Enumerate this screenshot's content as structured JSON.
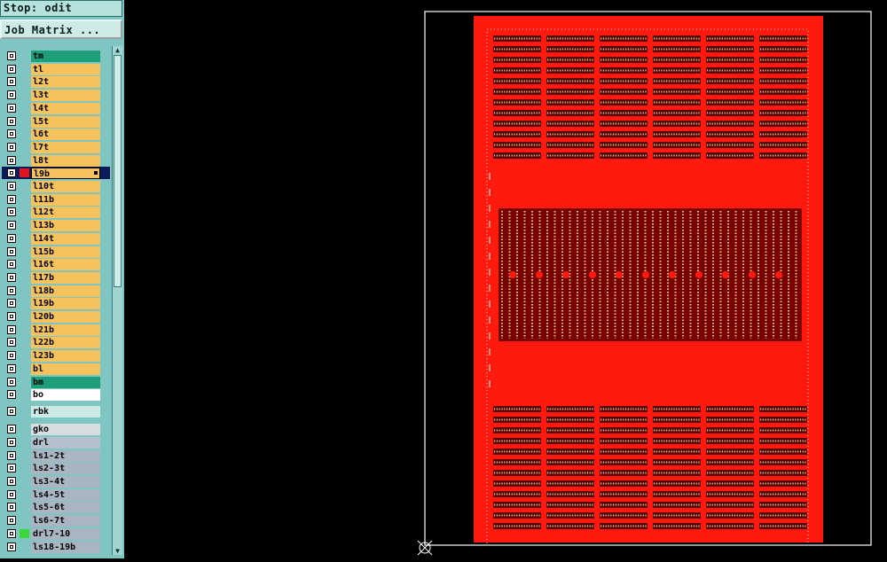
{
  "header": {
    "status": "Stop: odit",
    "job_button": "Job Matrix ..."
  },
  "layers": [
    {
      "name": "tm",
      "color": "#1f9e7a",
      "bg": "teal",
      "selected": false
    },
    {
      "name": "tl",
      "color": "#f6c25e",
      "bg": "gold",
      "selected": false
    },
    {
      "name": "l2t",
      "color": "#f6c25e",
      "bg": "gold",
      "selected": false
    },
    {
      "name": "l3t",
      "color": "#f6c25e",
      "bg": "gold",
      "selected": false
    },
    {
      "name": "l4t",
      "color": "#f6c25e",
      "bg": "gold",
      "selected": false
    },
    {
      "name": "l5t",
      "color": "#f6c25e",
      "bg": "gold",
      "selected": false
    },
    {
      "name": "l6t",
      "color": "#f6c25e",
      "bg": "gold",
      "selected": false
    },
    {
      "name": "l7t",
      "color": "#f6c25e",
      "bg": "gold",
      "selected": false
    },
    {
      "name": "l8t",
      "color": "#f6c25e",
      "bg": "gold",
      "selected": false
    },
    {
      "name": "l9b",
      "color": "#f6c25e",
      "bg": "gold",
      "selected": true
    },
    {
      "name": "l10t",
      "color": "#f6c25e",
      "bg": "gold",
      "selected": false
    },
    {
      "name": "l11b",
      "color": "#f6c25e",
      "bg": "gold",
      "selected": false
    },
    {
      "name": "l12t",
      "color": "#f6c25e",
      "bg": "gold",
      "selected": false
    },
    {
      "name": "l13b",
      "color": "#f6c25e",
      "bg": "gold",
      "selected": false
    },
    {
      "name": "l14t",
      "color": "#f6c25e",
      "bg": "gold",
      "selected": false
    },
    {
      "name": "l15b",
      "color": "#f6c25e",
      "bg": "gold",
      "selected": false
    },
    {
      "name": "l16t",
      "color": "#f6c25e",
      "bg": "gold",
      "selected": false
    },
    {
      "name": "l17b",
      "color": "#f6c25e",
      "bg": "gold",
      "selected": false
    },
    {
      "name": "l18b",
      "color": "#f6c25e",
      "bg": "gold",
      "selected": false
    },
    {
      "name": "l19b",
      "color": "#f6c25e",
      "bg": "gold",
      "selected": false
    },
    {
      "name": "l20b",
      "color": "#f6c25e",
      "bg": "gold",
      "selected": false
    },
    {
      "name": "l21b",
      "color": "#f6c25e",
      "bg": "gold",
      "selected": false
    },
    {
      "name": "l22b",
      "color": "#f6c25e",
      "bg": "gold",
      "selected": false
    },
    {
      "name": "l23b",
      "color": "#f6c25e",
      "bg": "gold",
      "selected": false
    },
    {
      "name": "bl",
      "color": "#f6c25e",
      "bg": "gold",
      "selected": false
    },
    {
      "name": "bm",
      "color": "#1f9e7a",
      "bg": "teal",
      "selected": false
    },
    {
      "name": "bo",
      "color": "#ffffff",
      "bg": "white",
      "selected": false
    },
    {
      "name": "rbk",
      "color": "#cdeae7",
      "bg": "light",
      "selected": false
    },
    {
      "name": "gko",
      "color": "#d8dde2",
      "bg": "grey",
      "selected": false
    },
    {
      "name": "drl",
      "color": "#b4c0cb",
      "bg": "grey",
      "selected": false
    },
    {
      "name": "ls1-2t",
      "color": "#a9b6c2",
      "bg": "grey",
      "selected": false
    },
    {
      "name": "ls2-3t",
      "color": "#a9b6c2",
      "bg": "grey",
      "selected": false
    },
    {
      "name": "ls3-4t",
      "color": "#a9b6c2",
      "bg": "grey",
      "selected": false
    },
    {
      "name": "ls4-5t",
      "color": "#a9b6c2",
      "bg": "grey",
      "selected": false
    },
    {
      "name": "ls5-6t",
      "color": "#a9b6c2",
      "bg": "grey",
      "selected": false
    },
    {
      "name": "ls6-7t",
      "color": "#a9b6c2",
      "bg": "grey",
      "selected": false
    },
    {
      "name": "drl7-10",
      "color": "#a9b6c2",
      "bg": "grey",
      "selected": false
    },
    {
      "name": "ls18-19b",
      "color": "#a9b6c2",
      "bg": "grey",
      "selected": false
    }
  ],
  "swatches": {
    "l9b": "#e0141e",
    "drl7-10": "#39d839"
  },
  "board": {
    "copper_color": "#ff1a10",
    "frame_color": "#ffffff",
    "pad_color": "#d9cf8a"
  }
}
